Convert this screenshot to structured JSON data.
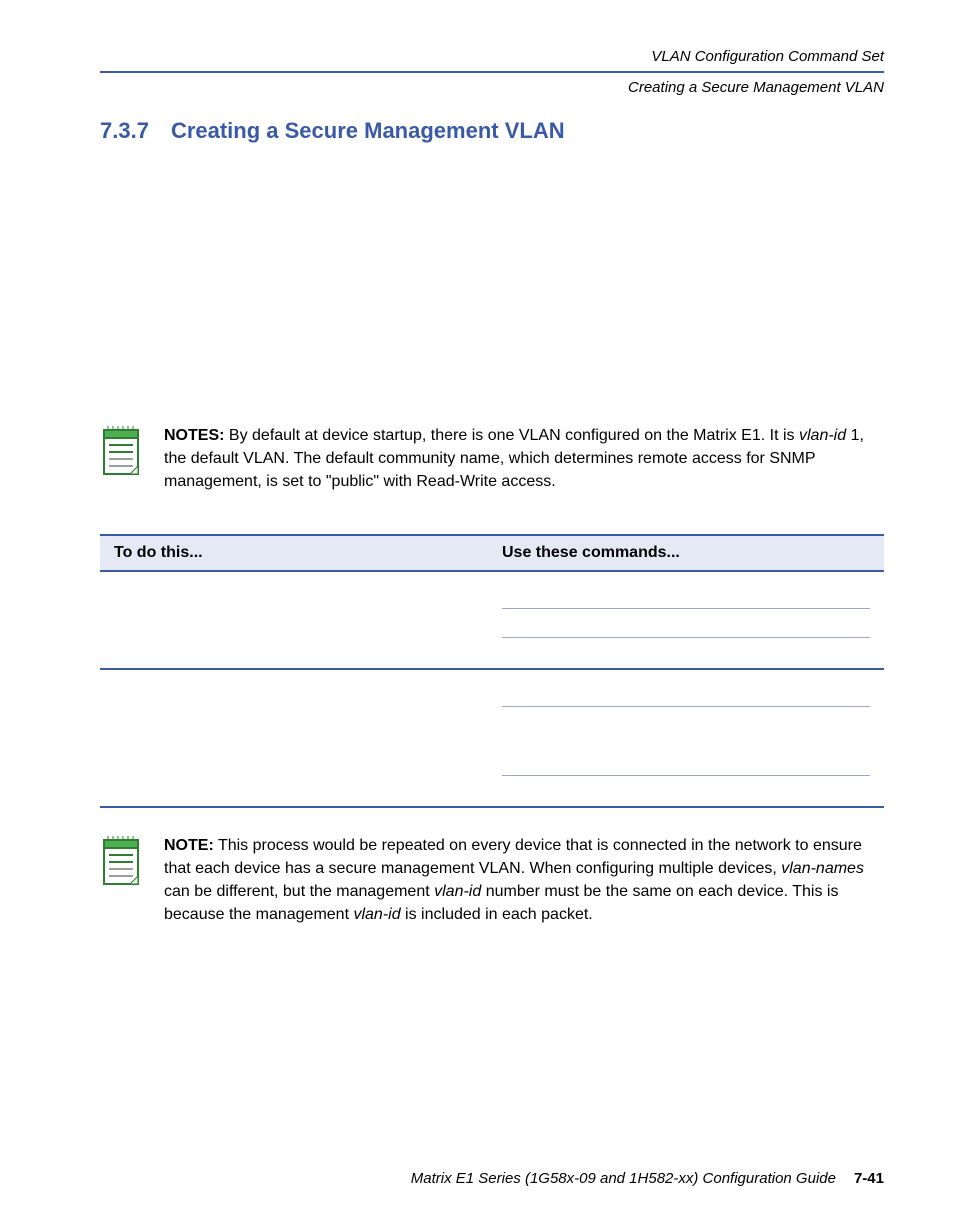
{
  "header": {
    "line1": "VLAN Configuration Command Set",
    "line2": "Creating a Secure Management VLAN"
  },
  "section": {
    "number": "7.3.7",
    "title": "Creating a Secure Management VLAN"
  },
  "note1": {
    "label": "NOTES:",
    "text_before_ital": "  By default at device startup, there is one VLAN configured on the Matrix E1. It is ",
    "ital": "vlan-id",
    "text_after_ital": " 1, the default VLAN. The default community name, which determines remote access for SNMP management, is set to \"public\" with Read-Write access."
  },
  "table": {
    "header_left": "To do this...",
    "header_right": "Use these commands..."
  },
  "note2": {
    "label": "NOTE:",
    "seg1": "  This process would be repeated on every device that is connected in the network to ensure that each device has a secure management VLAN. When configuring multiple devices, ",
    "ital1": "vlan-names",
    "seg2": " can be different, but the management ",
    "ital2": "vlan-id",
    "seg3": " number must be the same on each device. This is because the management ",
    "ital3": "vlan-id",
    "seg4": " is included in each packet."
  },
  "footer": {
    "title": "Matrix E1 Series (1G58x-09 and 1H582-xx) Configuration Guide",
    "page": "7-41"
  }
}
